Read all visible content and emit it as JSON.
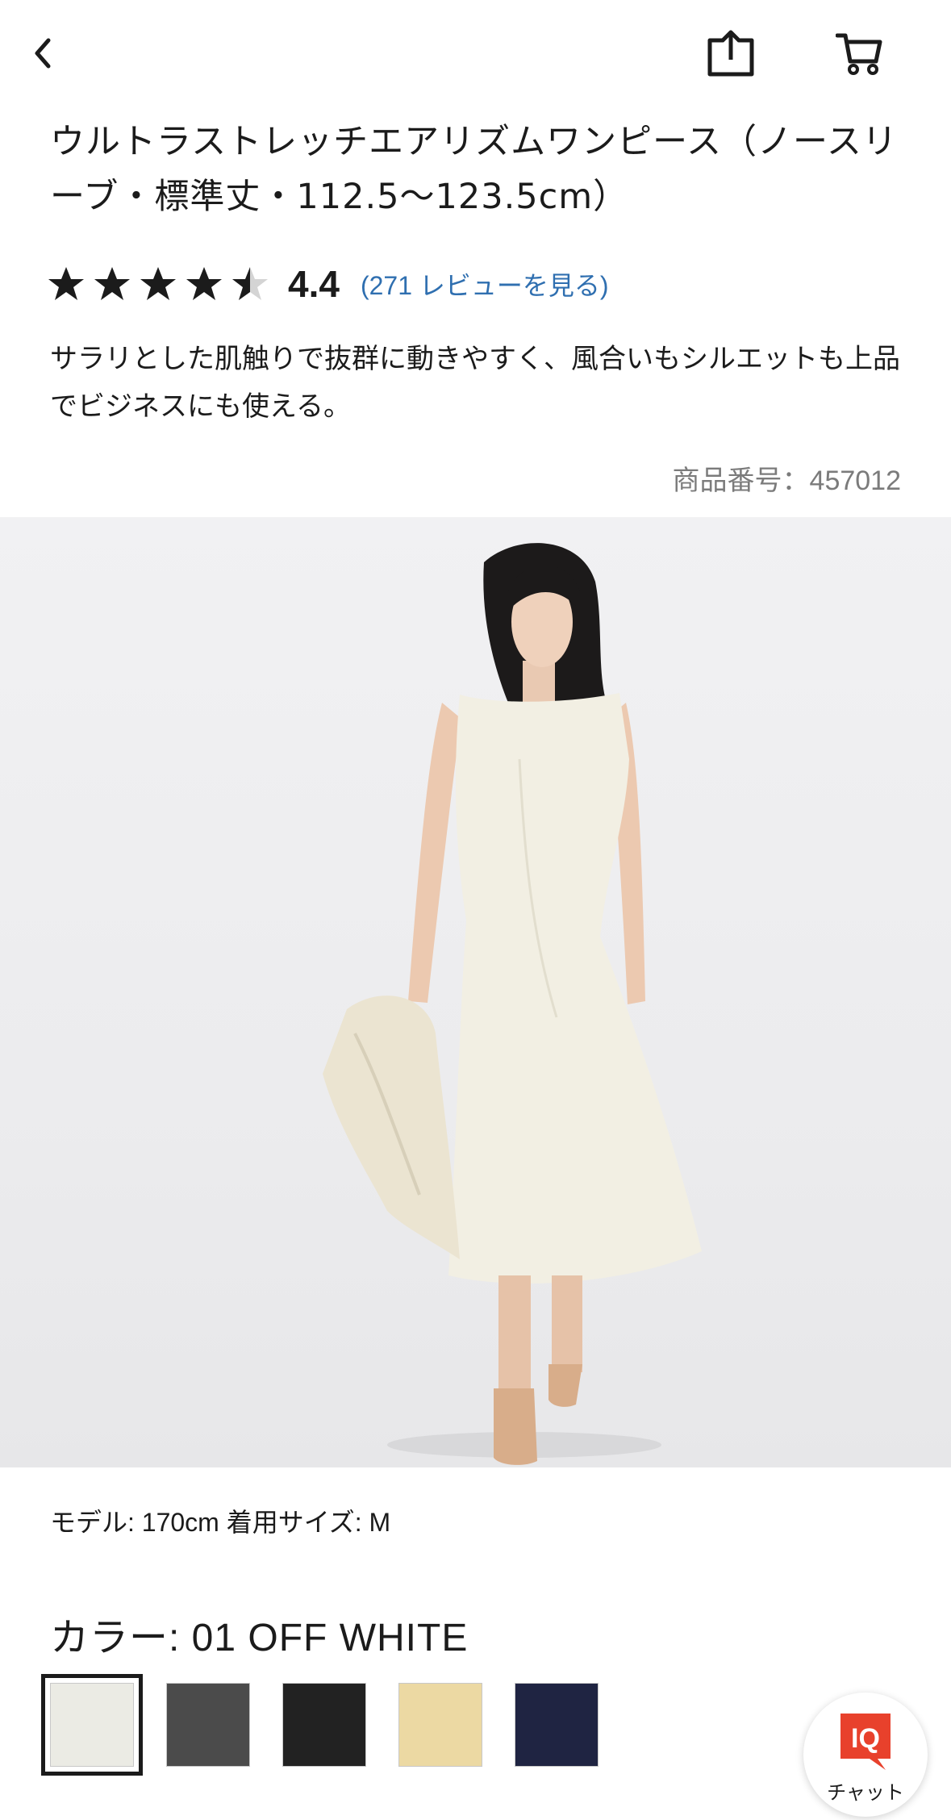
{
  "header": {
    "back_icon": "chevron-left-icon",
    "share_icon": "share-icon",
    "cart_icon": "cart-icon"
  },
  "product": {
    "title": "ウルトラストレッチエアリズムワンピース（ノースリーブ・標準丈・112.5〜123.5cm）",
    "rating": 4.4,
    "rating_text": "4.4",
    "review_link": "(271 レビューを見る)",
    "description": "サラリとした肌触りで抜群に動きやすく、風合いもシルエットも上品でビジネスにも使える。",
    "product_number": "商品番号：457012"
  },
  "photo": {
    "model_info": "モデル: 170cm 着用サイズ: M"
  },
  "color": {
    "label": "カラー: 01 OFF WHITE",
    "swatches": [
      {
        "color": "#ebebe4",
        "selected": true
      },
      {
        "color": "#4b4b4b",
        "selected": false
      },
      {
        "color": "#222222",
        "selected": false
      },
      {
        "color": "#ecd9a3",
        "selected": false
      },
      {
        "color": "#1f2442",
        "selected": false
      }
    ]
  },
  "chat": {
    "logo_text": "IQ",
    "label": "チャット",
    "brand_color": "#e8412c"
  }
}
